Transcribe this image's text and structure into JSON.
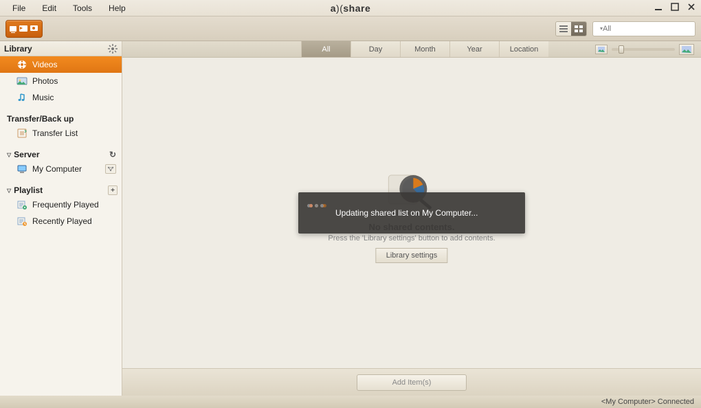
{
  "menu": {
    "file": "File",
    "edit": "Edit",
    "tools": "Tools",
    "help": "Help"
  },
  "brand": {
    "left": "a",
    "mid": ")(",
    "right": "share"
  },
  "search": {
    "placeholder": "All"
  },
  "sidebar": {
    "library_header": "Library",
    "items": [
      {
        "label": "Videos"
      },
      {
        "label": "Photos"
      },
      {
        "label": "Music"
      }
    ],
    "transfer_header": "Transfer/Back up",
    "transfer_item": "Transfer List",
    "server_header": "Server",
    "server_item": "My Computer",
    "playlist_header": "Playlist",
    "playlist_items": [
      {
        "label": "Frequently Played"
      },
      {
        "label": "Recently Played"
      }
    ]
  },
  "tabs": {
    "all": "All",
    "day": "Day",
    "month": "Month",
    "year": "Year",
    "location": "Location"
  },
  "empty": {
    "title": "No shared contents.",
    "subtitle": "Press the 'Library settings' button to add contents.",
    "button": "Library settings"
  },
  "toast": {
    "message": "Updating shared list on My Computer..."
  },
  "bottom": {
    "add": "Add Item(s)"
  },
  "status": {
    "text": "<My Computer>  Connected"
  }
}
